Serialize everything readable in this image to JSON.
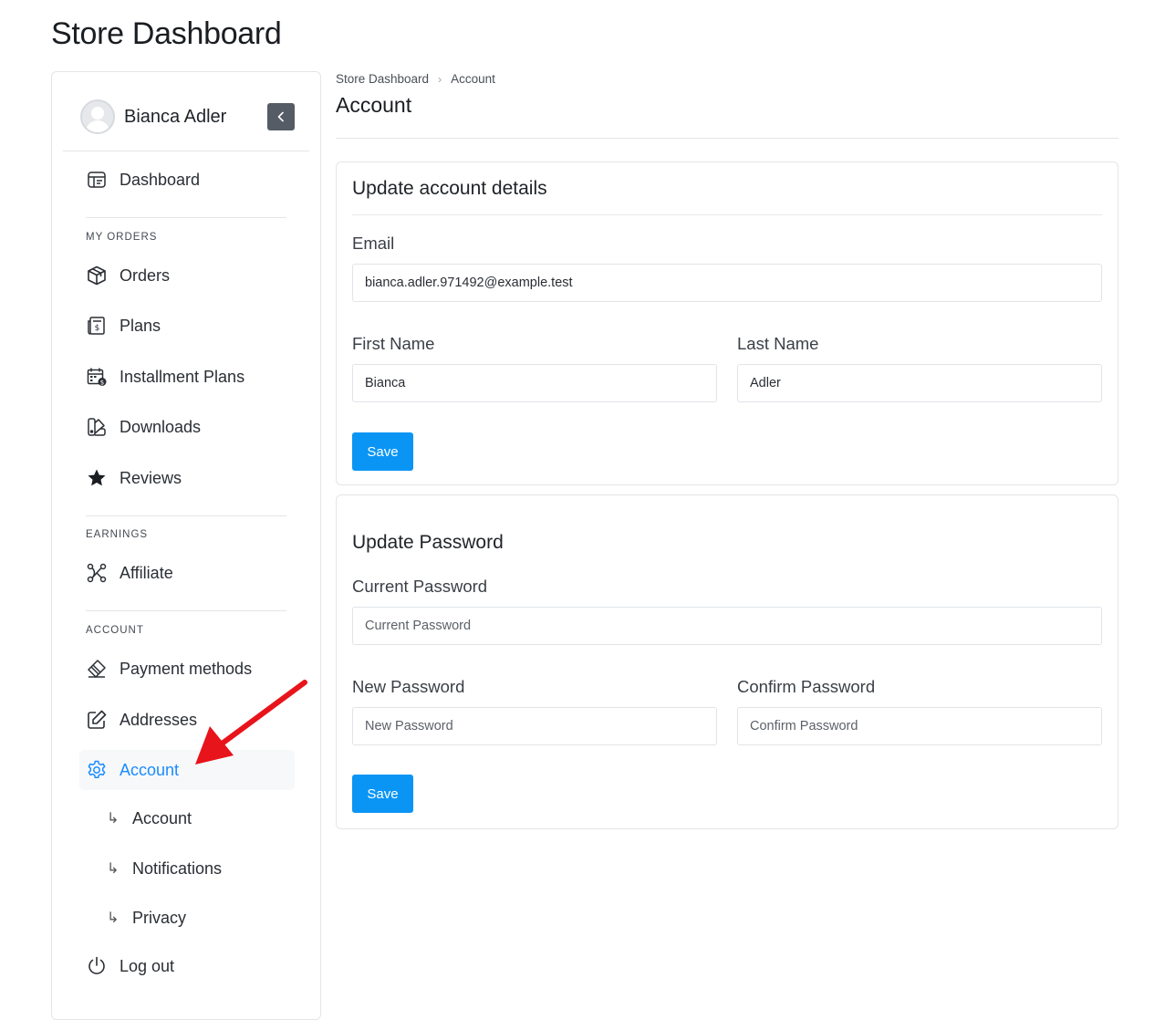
{
  "page": {
    "title": "Store Dashboard"
  },
  "profile": {
    "name": "Bianca Adler"
  },
  "sidebar": {
    "dashboard": "Dashboard",
    "sections": {
      "orders": "MY ORDERS",
      "earnings": "EARNINGS",
      "account": "ACCOUNT"
    },
    "items": {
      "orders": "Orders",
      "plans": "Plans",
      "installment_plans": "Installment Plans",
      "downloads": "Downloads",
      "reviews": "Reviews",
      "affiliate": "Affiliate",
      "payment_methods": "Payment methods",
      "addresses": "Addresses",
      "account": "Account",
      "logout": "Log out"
    },
    "sub_items": {
      "account": "Account",
      "notifications": "Notifications",
      "privacy": "Privacy"
    },
    "sub_arrow": "↳"
  },
  "breadcrumb": {
    "root": "Store Dashboard",
    "separator": "›",
    "current": "Account"
  },
  "main": {
    "title": "Account"
  },
  "account_details": {
    "title": "Update account details",
    "email_label": "Email",
    "email_value": "bianca.adler.971492@example.test",
    "first_name_label": "First Name",
    "first_name_value": "Bianca",
    "last_name_label": "Last Name",
    "last_name_value": "Adler",
    "save_label": "Save"
  },
  "password": {
    "title": "Update Password",
    "current_label": "Current Password",
    "current_placeholder": "Current Password",
    "new_label": "New Password",
    "new_placeholder": "New Password",
    "confirm_label": "Confirm Password",
    "confirm_placeholder": "Confirm Password",
    "save_label": "Save"
  },
  "colors": {
    "accent": "#1a8cff",
    "button": "#0a95f5",
    "collapse_button": "#565c66",
    "annotation": "#e8141b"
  }
}
